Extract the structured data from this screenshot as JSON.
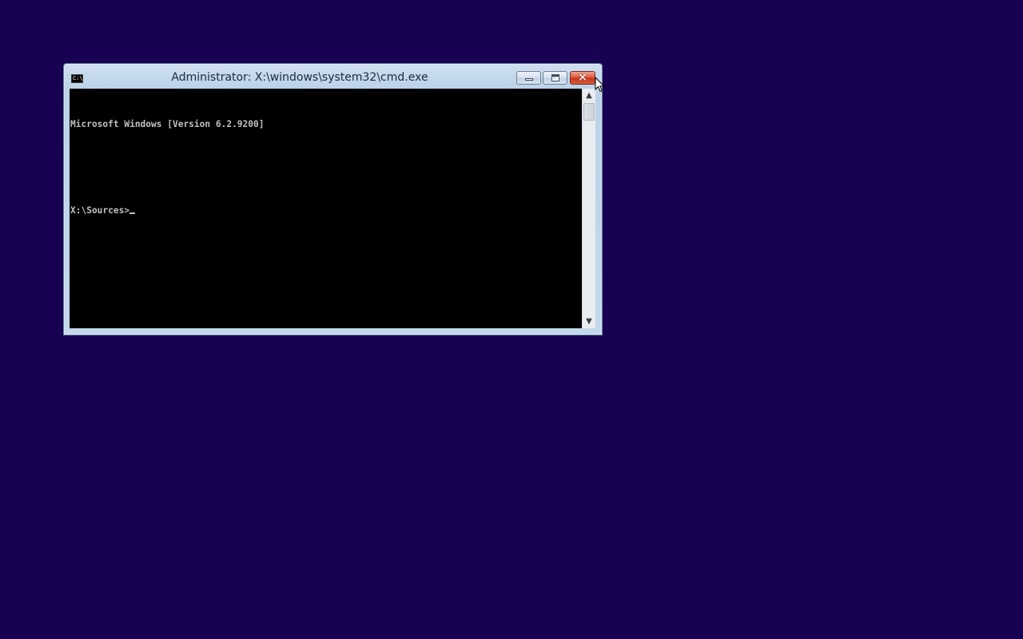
{
  "desktop": {
    "background_color": "#180052"
  },
  "window": {
    "title": "Administrator: X:\\windows\\system32\\cmd.exe",
    "icon": "console-icon",
    "icon_text": "C:\\.",
    "buttons": {
      "minimize": "minimize-icon",
      "maximize": "maximize-icon",
      "close": "close-icon",
      "close_glyph": "✕"
    }
  },
  "console": {
    "lines": [
      "Microsoft Windows [Version 6.2.9200]",
      ""
    ],
    "prompt": "X:\\Sources>",
    "text_color": "#c0c0c0",
    "background_color": "#000000"
  },
  "scrollbar": {
    "up_arrow": "▲",
    "down_arrow": "▼"
  }
}
